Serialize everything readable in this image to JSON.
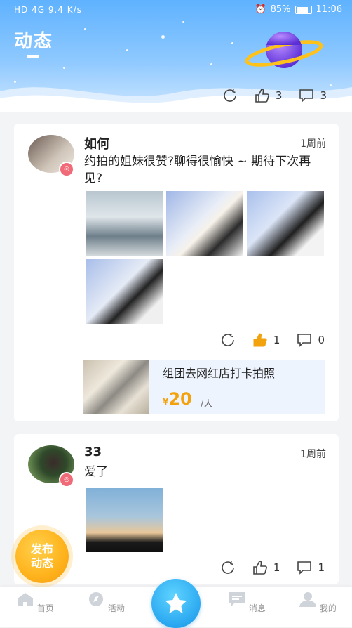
{
  "status_bar": {
    "network": "HD 4G 9.4 K/s",
    "battery": "85%",
    "time": "11:06"
  },
  "header": {
    "title": "动态"
  },
  "prev_post": {
    "likes": "3",
    "comments": "3"
  },
  "posts": [
    {
      "username": "如何",
      "time": "1周前",
      "text": "约拍的姐妹很赞?聊得很愉快 ~ 期待下次再见?",
      "likes": "1",
      "comments": "0",
      "activity": {
        "title": "组团去网红店打卡拍照",
        "currency": "¥",
        "price": "20",
        "unit": "/人"
      }
    },
    {
      "username": "33",
      "time": "1周前",
      "text": "爱了",
      "likes": "1",
      "comments": "1"
    }
  ],
  "post_button": {
    "line1": "发布",
    "line2": "动态"
  },
  "bottom_nav": [
    {
      "label": "首页",
      "icon": "home-icon"
    },
    {
      "label": "活动",
      "icon": "compass-icon"
    },
    {
      "label": "",
      "icon": "star-icon"
    },
    {
      "label": "消息",
      "icon": "message-icon"
    },
    {
      "label": "我的",
      "icon": "user-icon"
    }
  ],
  "colors": {
    "accent_blue": "#2aa7f0",
    "like_active": "#f2a20d",
    "price": "#f2a20d",
    "post_button": "#ffb51f"
  }
}
